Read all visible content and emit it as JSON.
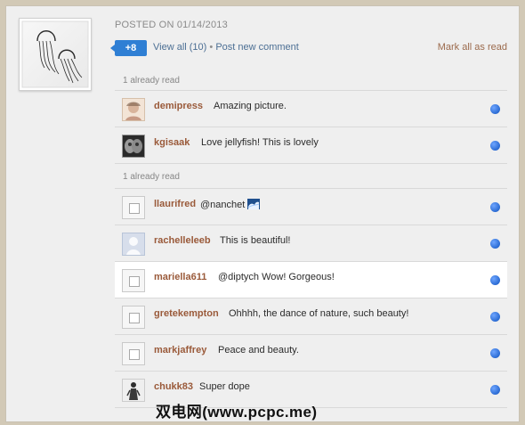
{
  "post": {
    "date_label": "POSTED ON 01/14/2013",
    "badge_count": "+8",
    "view_all": "View all (10)",
    "separator": "•",
    "post_comment": "Post new comment",
    "mark_all": "Mark all as read"
  },
  "sections": [
    {
      "label": "1 already read"
    },
    {
      "label": "1 already read"
    }
  ],
  "comments": [
    {
      "username": "demipress",
      "message": "Amazing picture.",
      "avatar_kind": "photo",
      "read_dot_color": "#2f6fd6"
    },
    {
      "username": "kgisaak",
      "message": "Love jellyfish! This is lovely",
      "avatar_kind": "photo",
      "read_dot_color": "#2f6fd6"
    },
    {
      "username": "llaurifred",
      "message": "@nanchet",
      "avatar_kind": "broken",
      "read_dot_color": "#2f6fd6"
    },
    {
      "username": "rachelleleeb",
      "message": "This is beautiful!",
      "avatar_kind": "placeholder",
      "read_dot_color": "#2f6fd6"
    },
    {
      "username": "mariella611",
      "message": "@diptych Wow! Gorgeous!",
      "avatar_kind": "broken",
      "read_dot_color": "#2f6fd6"
    },
    {
      "username": "gretekempton",
      "message": "Ohhhh, the dance of nature, such beauty!",
      "avatar_kind": "broken",
      "read_dot_color": "#2f6fd6"
    },
    {
      "username": "markjaffrey",
      "message": "Peace and beauty.",
      "avatar_kind": "broken",
      "read_dot_color": "#2f6fd6"
    },
    {
      "username": "chukk83",
      "message": "Super dope",
      "avatar_kind": "photo",
      "read_dot_color": "#2f6fd6"
    }
  ],
  "watermark": "双电网(www.pcpc.me)",
  "icons": {
    "read_dot": "blue-dot-icon",
    "emoji": "wave-emoji-icon"
  }
}
